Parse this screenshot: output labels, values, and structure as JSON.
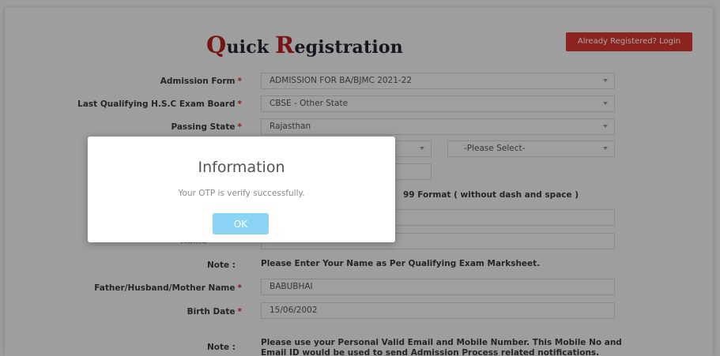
{
  "header": {
    "title_q": "Q",
    "title_uick": "uick",
    "title_r": "R",
    "title_egistration": "egistration",
    "login_button": "Already Registered? Login"
  },
  "form": {
    "admission_form": {
      "label": "Admission Form",
      "value": "ADMISSION FOR BA/BJMC 2021-22"
    },
    "exam_board": {
      "label": "Last Qualifying H.S.C Exam Board",
      "value": "CBSE - Other State"
    },
    "passing_state": {
      "label": "Passing State",
      "value": "Rajasthan"
    },
    "extra_select": {
      "value": "-Please Select-"
    },
    "format_hint": "99 Format ( without dash and space )",
    "name_label_partial": "Name",
    "note_label": "Note :",
    "name_note": "Please Enter Your Name as Per Qualifying Exam Marksheet.",
    "parent_name": {
      "label": "Father/Husband/Mother Name",
      "value": "BABUBHAI"
    },
    "birth_date": {
      "label": "Birth Date",
      "value": "15/06/2002"
    },
    "contact_note_line1": "Please use your Personal Valid Email and Mobile Number. This Mobile No and",
    "contact_note_line2": "Email ID would be used to send Admission Process related notifications.",
    "required_mark": "*"
  },
  "modal": {
    "title": "Information",
    "message": "Your OTP is verify successfully.",
    "ok_button": "OK"
  },
  "colors": {
    "brand_red": "#b51f23",
    "login_button": "#d7372e",
    "ok_button": "#8cd4f5",
    "required": "#d32f2f"
  }
}
